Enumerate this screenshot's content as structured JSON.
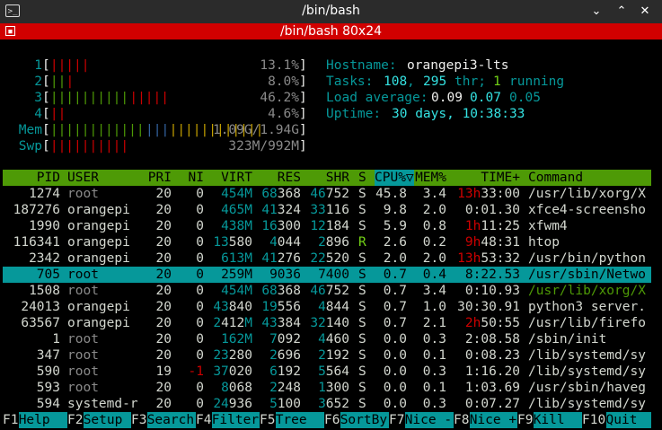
{
  "window": {
    "title": "/bin/bash",
    "tab_title": "/bin/bash 80x24"
  },
  "meters": {
    "cpu": [
      {
        "label": "1",
        "bar": [
          {
            "t": "|||||",
            "c": "red"
          }
        ],
        "value": "13.1%"
      },
      {
        "label": "2",
        "bar": [
          {
            "t": "||",
            "c": "green"
          },
          {
            "t": "|",
            "c": "red"
          }
        ],
        "value": "8.0%"
      },
      {
        "label": "3",
        "bar": [
          {
            "t": "||||||||||",
            "c": "green"
          },
          {
            "t": "|||||",
            "c": "red"
          }
        ],
        "value": "46.2%"
      },
      {
        "label": "4",
        "bar": [
          {
            "t": "||",
            "c": "red"
          }
        ],
        "value": "4.6%"
      }
    ],
    "mem": {
      "label": "Mem",
      "bar": [
        {
          "t": "||||||||||||",
          "c": "green"
        },
        {
          "t": "|||",
          "c": "blue"
        },
        {
          "t": "||||||||||||",
          "c": "yellow"
        }
      ],
      "value": "1.09G/1.94G"
    },
    "swp": {
      "label": "Swp",
      "bar": [
        {
          "t": "||||||||||",
          "c": "red"
        }
      ],
      "value": "323M/992M"
    }
  },
  "info": {
    "hostname_label": "Hostname:",
    "hostname": "orangepi3-lts",
    "tasks_label": "Tasks:",
    "tasks": "108",
    "thr": "295",
    "thr_label": "thr;",
    "running": "1",
    "running_label": "running",
    "load_label": "Load average:",
    "load1": "0.09",
    "load5": "0.07",
    "load15": "0.05",
    "uptime_label": "Uptime:",
    "uptime": "30 days, 10:38:33"
  },
  "columns": [
    "PID",
    "USER",
    "PRI",
    "NI",
    "VIRT",
    "RES",
    "SHR",
    "S",
    "CPU%▽",
    "MEM%",
    "TIME+",
    "Command"
  ],
  "processes": [
    {
      "pid": "1274",
      "user": "root",
      "pri": "20",
      "ni": "0",
      "virt": "454M",
      "res": "68368",
      "shr": "46752",
      "s": "S",
      "cpu": "45.8",
      "mem": "3.4",
      "time_h": "13h",
      "time_rest": "33:00",
      "cmd": "/usr/lib/xorg/X"
    },
    {
      "pid": "187276",
      "user": "orangepi",
      "pri": "20",
      "ni": "0",
      "virt": "465M",
      "res": "41324",
      "shr": "33116",
      "s": "S",
      "cpu": "9.8",
      "mem": "2.0",
      "time_h": "",
      "time_rest": "0:01.30",
      "cmd": "xfce4-screensho"
    },
    {
      "pid": "1990",
      "user": "orangepi",
      "pri": "20",
      "ni": "0",
      "virt": "438M",
      "res": "16300",
      "shr": "12184",
      "s": "S",
      "cpu": "5.9",
      "mem": "0.8",
      "time_h": "1h",
      "time_rest": "11:25",
      "cmd": "xfwm4"
    },
    {
      "pid": "116341",
      "user": "orangepi",
      "pri": "20",
      "ni": "0",
      "virt": "13580",
      "res": "4044",
      "shr": "2896",
      "s": "R",
      "cpu": "2.6",
      "mem": "0.2",
      "time_h": "9h",
      "time_rest": "48:31",
      "cmd": "htop"
    },
    {
      "pid": "2342",
      "user": "orangepi",
      "pri": "20",
      "ni": "0",
      "virt": "613M",
      "res": "41276",
      "shr": "22520",
      "s": "S",
      "cpu": "2.0",
      "mem": "2.0",
      "time_h": "13h",
      "time_rest": "53:32",
      "cmd": "/usr/bin/python"
    },
    {
      "pid": "705",
      "user": "root",
      "pri": "20",
      "ni": "0",
      "virt": "259M",
      "res": "9036",
      "shr": "7400",
      "s": "S",
      "cpu": "0.7",
      "mem": "0.4",
      "time_h": "",
      "time_rest": "8:22.53",
      "cmd": "/usr/sbin/Netwo",
      "selected": true
    },
    {
      "pid": "1508",
      "user": "root",
      "pri": "20",
      "ni": "0",
      "virt": "454M",
      "res": "68368",
      "shr": "46752",
      "s": "S",
      "cpu": "0.7",
      "mem": "3.4",
      "time_h": "",
      "time_rest": "0:10.93",
      "cmd": "/usr/lib/xorg/X",
      "thread": true
    },
    {
      "pid": "24013",
      "user": "orangepi",
      "pri": "20",
      "ni": "0",
      "virt": "43840",
      "res": "19556",
      "shr": "4844",
      "s": "S",
      "cpu": "0.7",
      "mem": "1.0",
      "time_h": "",
      "time_rest": "30:30.91",
      "cmd": "python3 server."
    },
    {
      "pid": "63567",
      "user": "orangepi",
      "pri": "20",
      "ni": "0",
      "virt": "2412M",
      "res": "43384",
      "shr": "32140",
      "s": "S",
      "cpu": "0.7",
      "mem": "2.1",
      "time_h": "2h",
      "time_rest": "50:55",
      "cmd": "/usr/lib/firefo"
    },
    {
      "pid": "1",
      "user": "root",
      "pri": "20",
      "ni": "0",
      "virt": "162M",
      "res": "7092",
      "shr": "4460",
      "s": "S",
      "cpu": "0.0",
      "mem": "0.3",
      "time_h": "",
      "time_rest": "2:08.58",
      "cmd": "/sbin/init"
    },
    {
      "pid": "347",
      "user": "root",
      "pri": "20",
      "ni": "0",
      "virt": "23280",
      "res": "2696",
      "shr": "2192",
      "s": "S",
      "cpu": "0.0",
      "mem": "0.1",
      "time_h": "",
      "time_rest": "0:08.23",
      "cmd": "/lib/systemd/sy"
    },
    {
      "pid": "590",
      "user": "root",
      "pri": "19",
      "ni": "-1",
      "virt": "37020",
      "res": "6192",
      "shr": "5564",
      "s": "S",
      "cpu": "0.0",
      "mem": "0.3",
      "time_h": "",
      "time_rest": "1:16.20",
      "cmd": "/lib/systemd/sy"
    },
    {
      "pid": "593",
      "user": "root",
      "pri": "20",
      "ni": "0",
      "virt": "8068",
      "res": "2248",
      "shr": "1300",
      "s": "S",
      "cpu": "0.0",
      "mem": "0.1",
      "time_h": "",
      "time_rest": "1:03.69",
      "cmd": "/usr/sbin/haveg"
    },
    {
      "pid": "594",
      "user": "systemd-r",
      "pri": "20",
      "ni": "0",
      "virt": "24936",
      "res": "5100",
      "shr": "3652",
      "s": "S",
      "cpu": "0.0",
      "mem": "0.3",
      "time_h": "",
      "time_rest": "0:07.27",
      "cmd": "/lib/systemd/sy"
    }
  ],
  "function_keys": [
    {
      "key": "F1",
      "label": "Help"
    },
    {
      "key": "F2",
      "label": "Setup"
    },
    {
      "key": "F3",
      "label": "Search"
    },
    {
      "key": "F4",
      "label": "Filter"
    },
    {
      "key": "F5",
      "label": "Tree"
    },
    {
      "key": "F6",
      "label": "SortBy"
    },
    {
      "key": "F7",
      "label": "Nice -"
    },
    {
      "key": "F8",
      "label": "Nice +"
    },
    {
      "key": "F9",
      "label": "Kill"
    },
    {
      "key": "F10",
      "label": "Quit"
    }
  ],
  "colors": {
    "titlebar": "#2b2b2b",
    "tabbar": "#d10000",
    "header": "#4e9a06",
    "selection": "#06989a"
  }
}
